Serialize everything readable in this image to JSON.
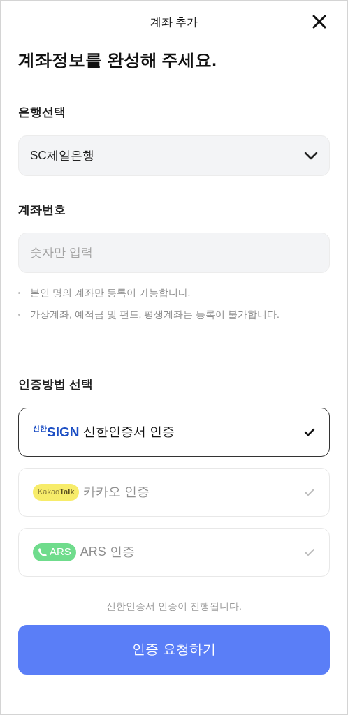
{
  "header": {
    "title": "계좌 추가"
  },
  "heading": "계좌정보를 완성해 주세요.",
  "bank": {
    "label": "은행선택",
    "value": "SC제일은행"
  },
  "account": {
    "label": "계좌번호",
    "placeholder": "숫자만 입력"
  },
  "notes": [
    "본인 명의 계좌만 등록이 가능합니다.",
    "가상계좌, 예적금 및 펀드, 평생계좌는 등록이 불가합니다."
  ],
  "auth": {
    "label": "인증방법 선택",
    "methods": [
      {
        "kind": "sign",
        "badge_small": "신한",
        "badge": "SIGN",
        "label": "신한인증서 인증",
        "selected": true
      },
      {
        "kind": "kakao",
        "badge_small": "Kakao",
        "badge": "Talk",
        "label": "카카오 인증",
        "selected": false
      },
      {
        "kind": "ars",
        "badge": "ARS",
        "label": "ARS 인증",
        "selected": false
      }
    ]
  },
  "footer_note": "신한인증서 인증이 진행됩니다.",
  "submit": "인증 요청하기"
}
